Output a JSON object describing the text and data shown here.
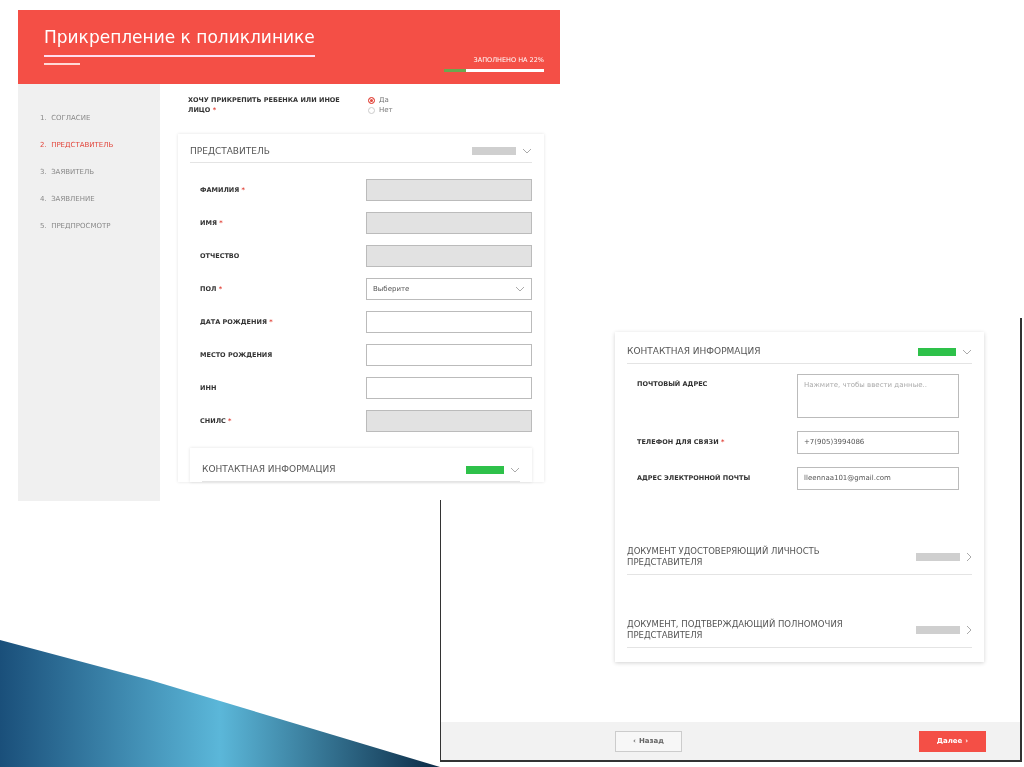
{
  "form_window": {
    "title": "Прикрепление к поликлинике",
    "progress": {
      "label": "ЗАПОЛНЕНО НА 22%",
      "level": 0.22
    },
    "steps": [
      {
        "label": "1.  СОГЛАСИЕ",
        "selected": false
      },
      {
        "label": "2.  ПРЕДСТАВИТЕЛЬ",
        "selected": true
      },
      {
        "label": "3.  ЗАЯВИТЕЛЬ",
        "selected": false
      },
      {
        "label": "4.  ЗАЯВЛЕНИЕ",
        "selected": false
      },
      {
        "label": "5.  ПРЕДПРОСМОТР",
        "selected": false
      }
    ],
    "question": {
      "label": "ХОЧУ ПРИКРЕПИТЬ РЕБЕНКА ИЛИ ИНОЕ ЛИЦО",
      "mark": "*",
      "options": [
        {
          "label": "Да",
          "selected": true
        },
        {
          "label": "Нет",
          "selected": false
        }
      ]
    },
    "section": {
      "title": "ПРЕДСТАВИТЕЛЬ",
      "filled": false,
      "fields": [
        {
          "label": "ФАМИЛИЯ",
          "mark": "*",
          "kind": "text",
          "disabled": true
        },
        {
          "label": "ИМЯ",
          "mark": "*",
          "kind": "text",
          "disabled": true
        },
        {
          "label": "ОТЧЕСТВО",
          "kind": "text",
          "disabled": true
        },
        {
          "label": "ПОЛ",
          "mark": "*",
          "kind": "select",
          "disabled": false,
          "value": "Выберите"
        },
        {
          "label": "ДАТА РОЖДЕНИЯ",
          "mark": "*",
          "kind": "text",
          "disabled": false
        },
        {
          "label": "МЕСТО РОЖДЕНИЯ",
          "kind": "text",
          "disabled": false
        },
        {
          "label": "ИНН",
          "kind": "text",
          "disabled": false
        },
        {
          "label": "СНИЛС",
          "mark": "*",
          "kind": "text",
          "disabled": true
        }
      ]
    },
    "next_section": {
      "title": "КОНТАКТНАЯ ИНФОРМАЦИЯ",
      "filled": true
    }
  },
  "contact_window": {
    "section": {
      "title": "КОНТАКТНАЯ ИНФОРМАЦИЯ",
      "filled": true,
      "fields": [
        {
          "label": "ПОЧТОВЫЙ АДРЕС",
          "kind": "textarea",
          "placeholder": "Нажмите, чтобы ввести данные.."
        },
        {
          "label": "ТЕЛЕФОН ДЛЯ СВЯЗИ",
          "mark": "*",
          "kind": "text",
          "value": "+7(905)3994086"
        },
        {
          "label": "АДРЕС ЭЛЕКТРОННОЙ ПОЧТЫ",
          "kind": "text",
          "value": "lleennaa101@gmail.com"
        }
      ]
    },
    "documents": [
      {
        "title": "ДОКУМЕНТ УДОСТОВЕРЯЮЩИЙ ЛИЧНОСТЬ ПРЕДСТАВИТЕЛЯ",
        "filled": false
      },
      {
        "title": "ДОКУМЕНТ, ПОДТВЕРЖДАЮЩИЙ ПОЛНОМОЧИЯ ПРЕДСТАВИТЕЛЯ",
        "filled": false
      }
    ],
    "buttons": [
      {
        "label": "Назад",
        "kind": "back",
        "icon": "‹"
      },
      {
        "label": "Далее",
        "kind": "next",
        "icon": "›"
      }
    ]
  }
}
